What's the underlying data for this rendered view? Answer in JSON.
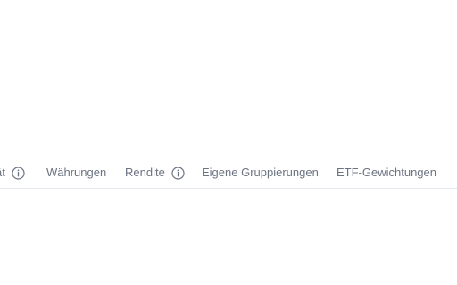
{
  "tabs": [
    {
      "label": "ät",
      "has_info": true
    },
    {
      "label": "Währungen",
      "has_info": false
    },
    {
      "label": "Rendite",
      "has_info": true
    },
    {
      "label": "Eigene Gruppierungen",
      "has_info": false
    },
    {
      "label": "ETF-Gewichtungen",
      "has_info": false
    }
  ],
  "colors": {
    "tab_text": "#6b7382",
    "divider": "#e4e7eb",
    "background": "#ffffff"
  },
  "icons": {
    "info": "info-circle-icon"
  }
}
